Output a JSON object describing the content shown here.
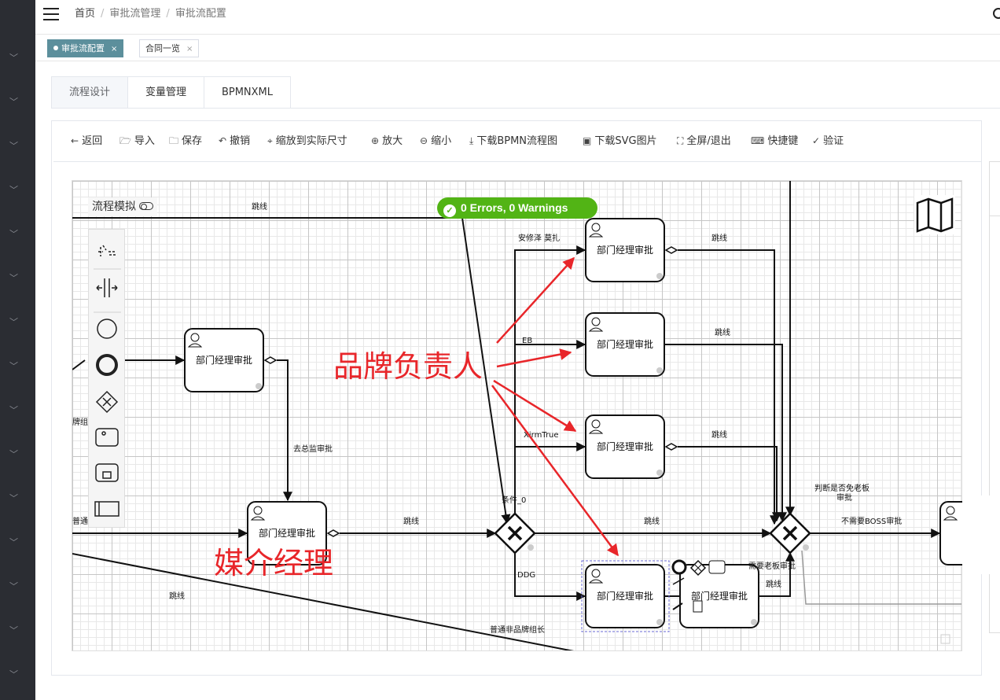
{
  "breadcrumb": {
    "home": "首页",
    "level1": "审批流管理",
    "level2": "审批流配置",
    "sep": "/"
  },
  "tags": [
    {
      "label": "审批流配置",
      "close": "×",
      "active": true
    },
    {
      "label": "合同一览",
      "close": "×",
      "active": false
    }
  ],
  "tabs": [
    {
      "label": "流程设计",
      "active": true
    },
    {
      "label": "变量管理",
      "active": false
    },
    {
      "label": "BPMNXML",
      "active": false
    }
  ],
  "toolbar": {
    "back": "返回",
    "import": "导入",
    "save": "保存",
    "undo": "撤销",
    "fit": "缩放到实际尺寸",
    "zoom_in": "放大",
    "zoom_out": "缩小",
    "download_bpmn": "下载BPMN流程图",
    "download_svg": "下载SVG图片",
    "fullscreen": "全屏/退出",
    "shortcuts": "快捷键",
    "validate": "验证"
  },
  "simulation": {
    "label": "流程模拟"
  },
  "validation": {
    "text": "0 Errors, 0 Warnings"
  },
  "tasks": [
    {
      "id": "t1",
      "label": "部门经理审批"
    },
    {
      "id": "t2",
      "label": "部门经理审批"
    },
    {
      "id": "t3",
      "label": "部门经理审批"
    },
    {
      "id": "t4",
      "label": "部门经理审批"
    },
    {
      "id": "t5",
      "label": "部门经理审批"
    },
    {
      "id": "t6",
      "label": "部门经理审批"
    },
    {
      "id": "t7",
      "label": "部门经理审批"
    }
  ],
  "flow_labels": {
    "top_jump": "跳线",
    "anxiuze": "安修泽 莫扎",
    "jump_t1": "跳线",
    "eb": "EB",
    "jump_t2": "跳线",
    "xirmtrue": "XirmTrue",
    "jump_t3": "跳线",
    "to_director": "去总监审批",
    "cond0": "条件_0",
    "jump_mid": "跳线",
    "jump_mid2": "跳线",
    "ddg": "DDG",
    "judge_boss": "判断是否免老板",
    "judge_boss2": "审批",
    "no_boss": "不需要BOSS审批",
    "need_boss": "需要老板审批",
    "jump_t7": "跳线",
    "normal": "普通",
    "brand_group": "牌组",
    "jump_bottom": "跳线",
    "normal_non_brand": "普通非品牌组长"
  },
  "annotations": {
    "brand_owner": "品牌负责人",
    "media_manager": "媒介经理",
    "annotation_color": "#e8262a"
  },
  "colors": {
    "tag_active": "#5c8f9c",
    "sidebar": "#2b2d33",
    "badge": "#52b415"
  }
}
